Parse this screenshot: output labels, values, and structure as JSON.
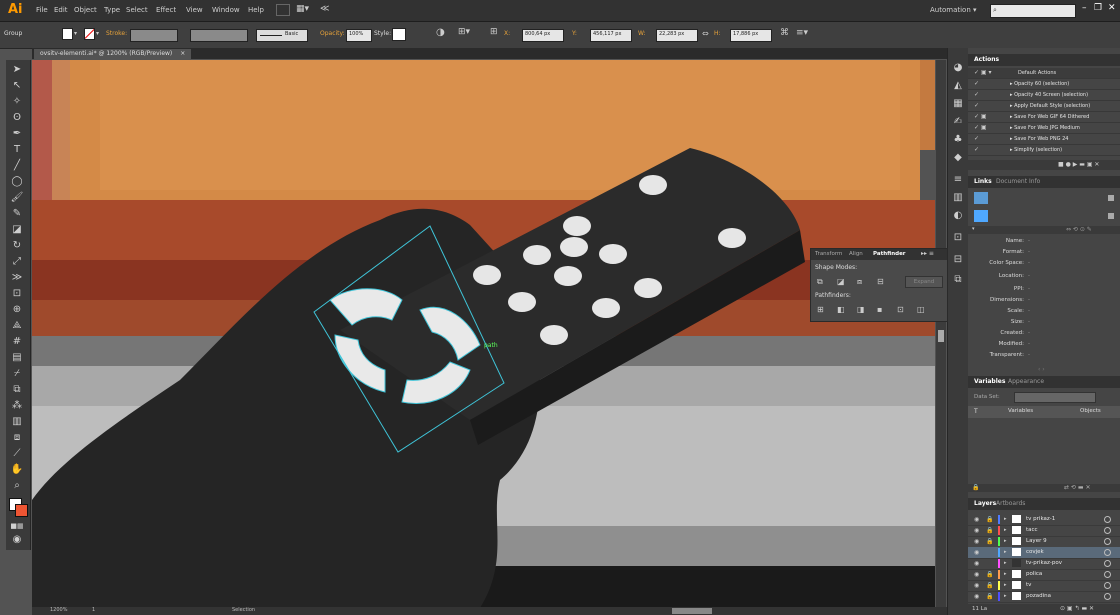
{
  "app": {
    "logo": "Ai"
  },
  "menu": [
    "File",
    "Edit",
    "Object",
    "Type",
    "Select",
    "Effect",
    "View",
    "Window",
    "Help"
  ],
  "workspace": "Automation",
  "control": {
    "selection": "Group",
    "stroke_label": "Stroke:",
    "brush": "Basic",
    "opacity_label": "Opacity:",
    "opacity": "100%",
    "style_label": "Style:",
    "x_label": "X:",
    "x": "800,64 px",
    "y_label": "Y:",
    "y": "456,117 px",
    "w_label": "W:",
    "w": "22,283 px",
    "h_label": "H:",
    "h": "17,886 px"
  },
  "doc_tab": {
    "title": "ovsitv-elementi.ai* @ 1200% (RGB/Preview)",
    "close": "×"
  },
  "canvas": {
    "path_label": "path"
  },
  "status": {
    "zoom": "1200%",
    "page": "1",
    "mode": "Selection"
  },
  "actions": {
    "tab": "Actions",
    "items": [
      {
        "label": "Default Actions",
        "folder": true
      },
      {
        "label": "Opacity 60 (selection)"
      },
      {
        "label": "Opacity 40 Screen (selection)"
      },
      {
        "label": "Apply Default Style (selection)"
      },
      {
        "label": "Save For Web GIF 64 Dithered"
      },
      {
        "label": "Save For Web JPG Medium"
      },
      {
        "label": "Save For Web PNG 24"
      },
      {
        "label": "Simplify (selection)"
      }
    ]
  },
  "links": {
    "tabs": [
      "Links",
      "Document Info"
    ],
    "info": [
      {
        "label": "Name:",
        "value": "-"
      },
      {
        "label": "Format:",
        "value": "-"
      },
      {
        "label": "Color Space:",
        "value": "-"
      },
      {
        "label": "Location:",
        "value": "-"
      },
      {
        "label": "PPI:",
        "value": "-"
      },
      {
        "label": "Dimensions:",
        "value": "-"
      },
      {
        "label": "Scale:",
        "value": "-"
      },
      {
        "label": "Size:",
        "value": "-"
      },
      {
        "label": "Created:",
        "value": "-"
      },
      {
        "label": "Modified:",
        "value": "-"
      },
      {
        "label": "Transparent:",
        "value": "-"
      }
    ]
  },
  "variables": {
    "tabs": [
      "Variables",
      "Appearance"
    ],
    "data_set": "Data Set:",
    "col_variables": "Variables",
    "col_objects": "Objects"
  },
  "layers": {
    "tabs": [
      "Layers",
      "Artboards"
    ],
    "items": [
      {
        "name": "tv prikaz-1",
        "color": "#4f7bff"
      },
      {
        "name": "tacc",
        "color": "#ff4f4f"
      },
      {
        "name": "Layer 9",
        "color": "#4fff4f"
      },
      {
        "name": "covjek",
        "color": "#4fa8ff",
        "selected": true
      },
      {
        "name": "tv-prikaz-pov",
        "color": "#ff4fff"
      },
      {
        "name": "polica",
        "color": "#ff9d4f"
      },
      {
        "name": "tv",
        "color": "#ffff4f"
      },
      {
        "name": "pozadina",
        "color": "#4f4fff"
      }
    ],
    "footer": "11 La"
  },
  "pathfinder": {
    "tabs": [
      "Transform",
      "Align",
      "Pathfinder"
    ],
    "shape_modes": "Shape Modes:",
    "pathfinders": "Pathfinders:",
    "expand": "Expand"
  }
}
